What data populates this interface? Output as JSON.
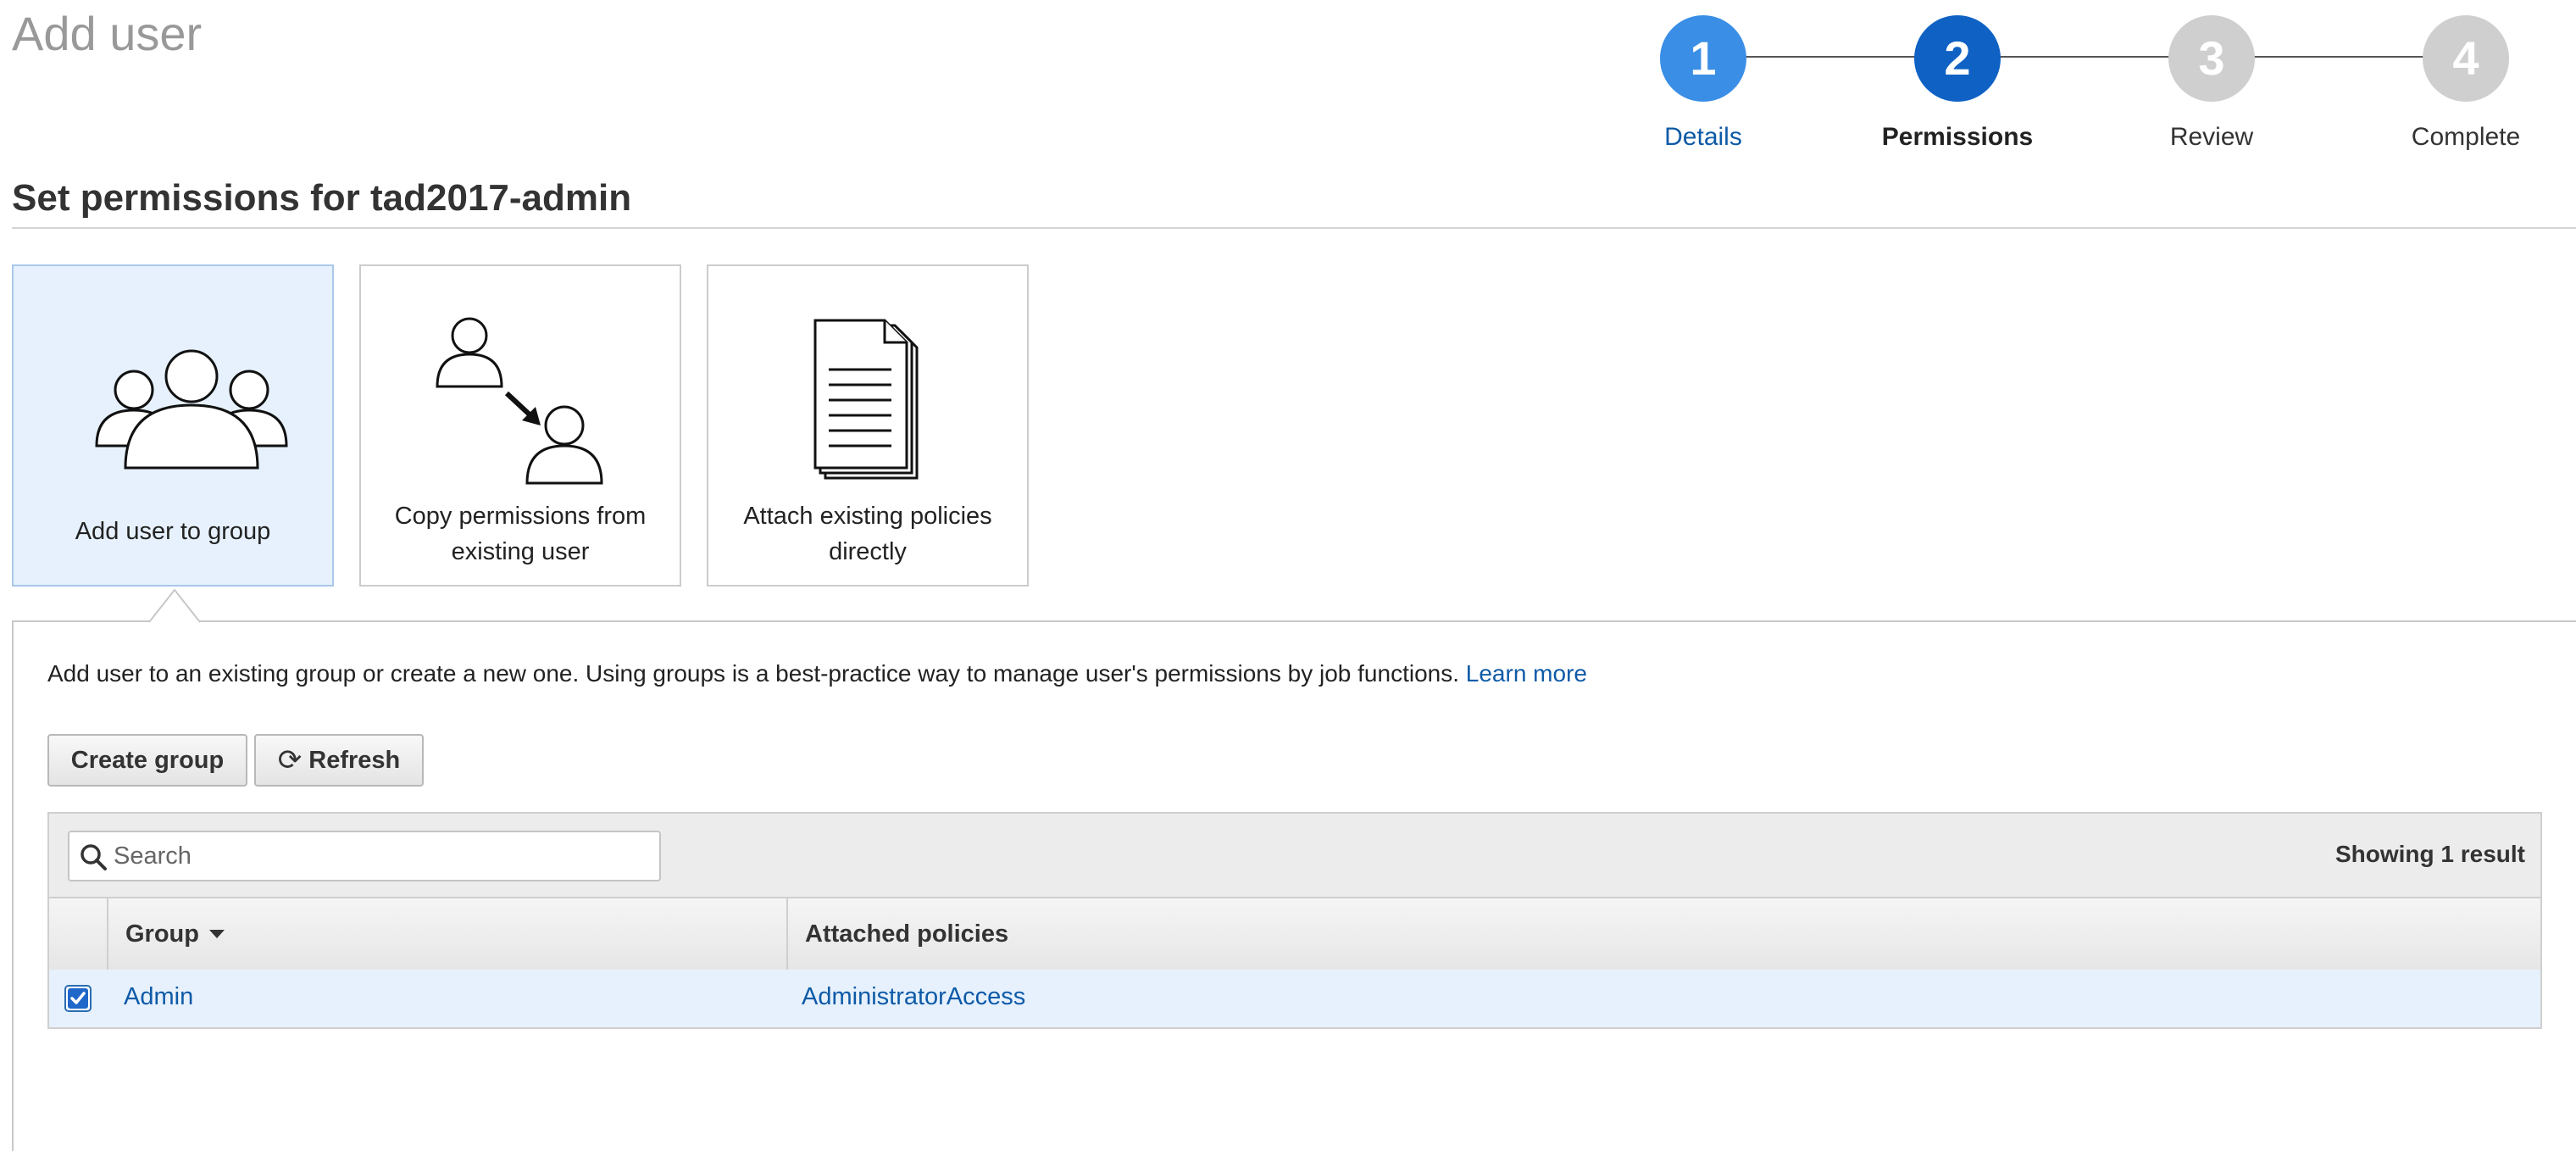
{
  "page": {
    "title": "Add user"
  },
  "stepper": {
    "steps": [
      {
        "number": "1",
        "label": "Details",
        "state": "done",
        "color": "#3a8ee6",
        "label_color": "#0e5aa7"
      },
      {
        "number": "2",
        "label": "Permissions",
        "state": "current",
        "color": "#0f62c4",
        "label_color": "#222222"
      },
      {
        "number": "3",
        "label": "Review",
        "state": "upcoming",
        "color": "#cfcfcf",
        "label_color": "#333333"
      },
      {
        "number": "4",
        "label": "Complete",
        "state": "upcoming",
        "color": "#cfcfcf",
        "label_color": "#333333"
      }
    ]
  },
  "section": {
    "title": "Set permissions for tad2017-admin"
  },
  "options": [
    {
      "label": "Add user to group",
      "icon": "user-group-icon",
      "selected": true
    },
    {
      "label_line1": "Copy permissions from",
      "label_line2": "existing user",
      "icon": "copy-permissions-icon",
      "selected": false
    },
    {
      "label_line1": "Attach existing policies",
      "label_line2": "directly",
      "icon": "policy-document-icon",
      "selected": false
    }
  ],
  "panel": {
    "description": "Add user to an existing group or create a new one. Using groups is a best-practice way to manage user's permissions by job functions.",
    "learn_more": "Learn more",
    "create_group_label": "Create group",
    "refresh_label": "Refresh",
    "search_placeholder": "Search",
    "search_value": "",
    "result_count": "Showing 1 result"
  },
  "table": {
    "columns": [
      "Group",
      "Attached policies"
    ],
    "sort_column": "Group",
    "rows": [
      {
        "group": "Admin",
        "policies": "AdministratorAccess",
        "checked": true
      }
    ]
  },
  "colors": {
    "link": "#0e5aa7",
    "selected_bg": "#e6f1fd",
    "accent": "#2b6cb0"
  }
}
